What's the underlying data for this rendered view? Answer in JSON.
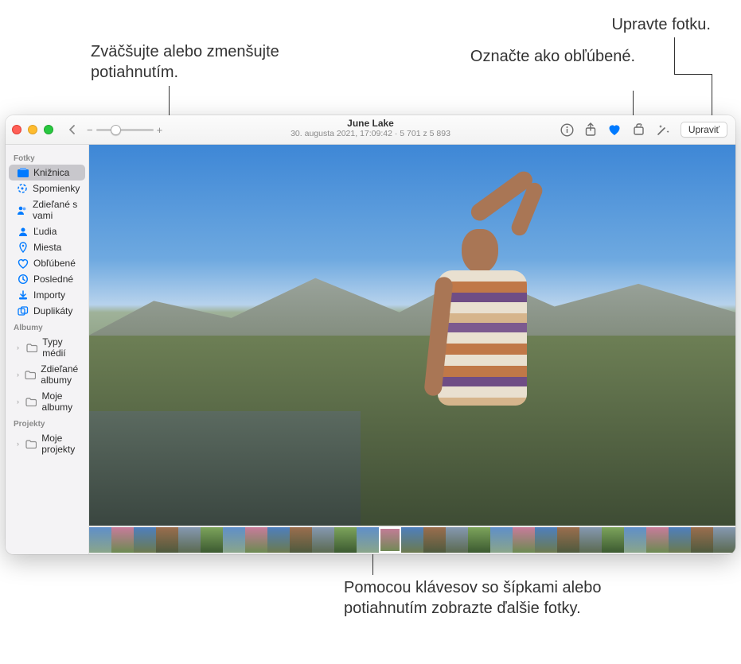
{
  "callouts": {
    "zoom": "Zväčšujte alebo zmenšujte potiahnutím.",
    "favorite": "Označte ako obľúbené.",
    "edit": "Upravte fotku.",
    "navigate": "Pomocou klávesov so šípkami alebo potiahnutím zobrazte ďalšie fotky."
  },
  "toolbar": {
    "title": "June Lake",
    "subtitle": "30. augusta 2021, 17:09:42 · 5 701 z 5 893",
    "edit_label": "Upraviť"
  },
  "sidebar": {
    "sections": {
      "fotky": "Fotky",
      "albumy": "Albumy",
      "projekty": "Projekty"
    },
    "items": {
      "kniznica": "Knižnica",
      "spomienky": "Spomienky",
      "zdielane_s_vami": "Zdieľané s vami",
      "ludia": "Ľudia",
      "miesta": "Miesta",
      "oblubene": "Obľúbené",
      "posledne": "Posledné",
      "importy": "Importy",
      "duplikaty": "Duplikáty",
      "typy_medii": "Typy médií",
      "zdielane_albumy": "Zdieľané albumy",
      "moje_albumy": "Moje albumy",
      "moje_projekty": "Moje projekty"
    }
  },
  "colors": {
    "accent": "#007aff"
  }
}
